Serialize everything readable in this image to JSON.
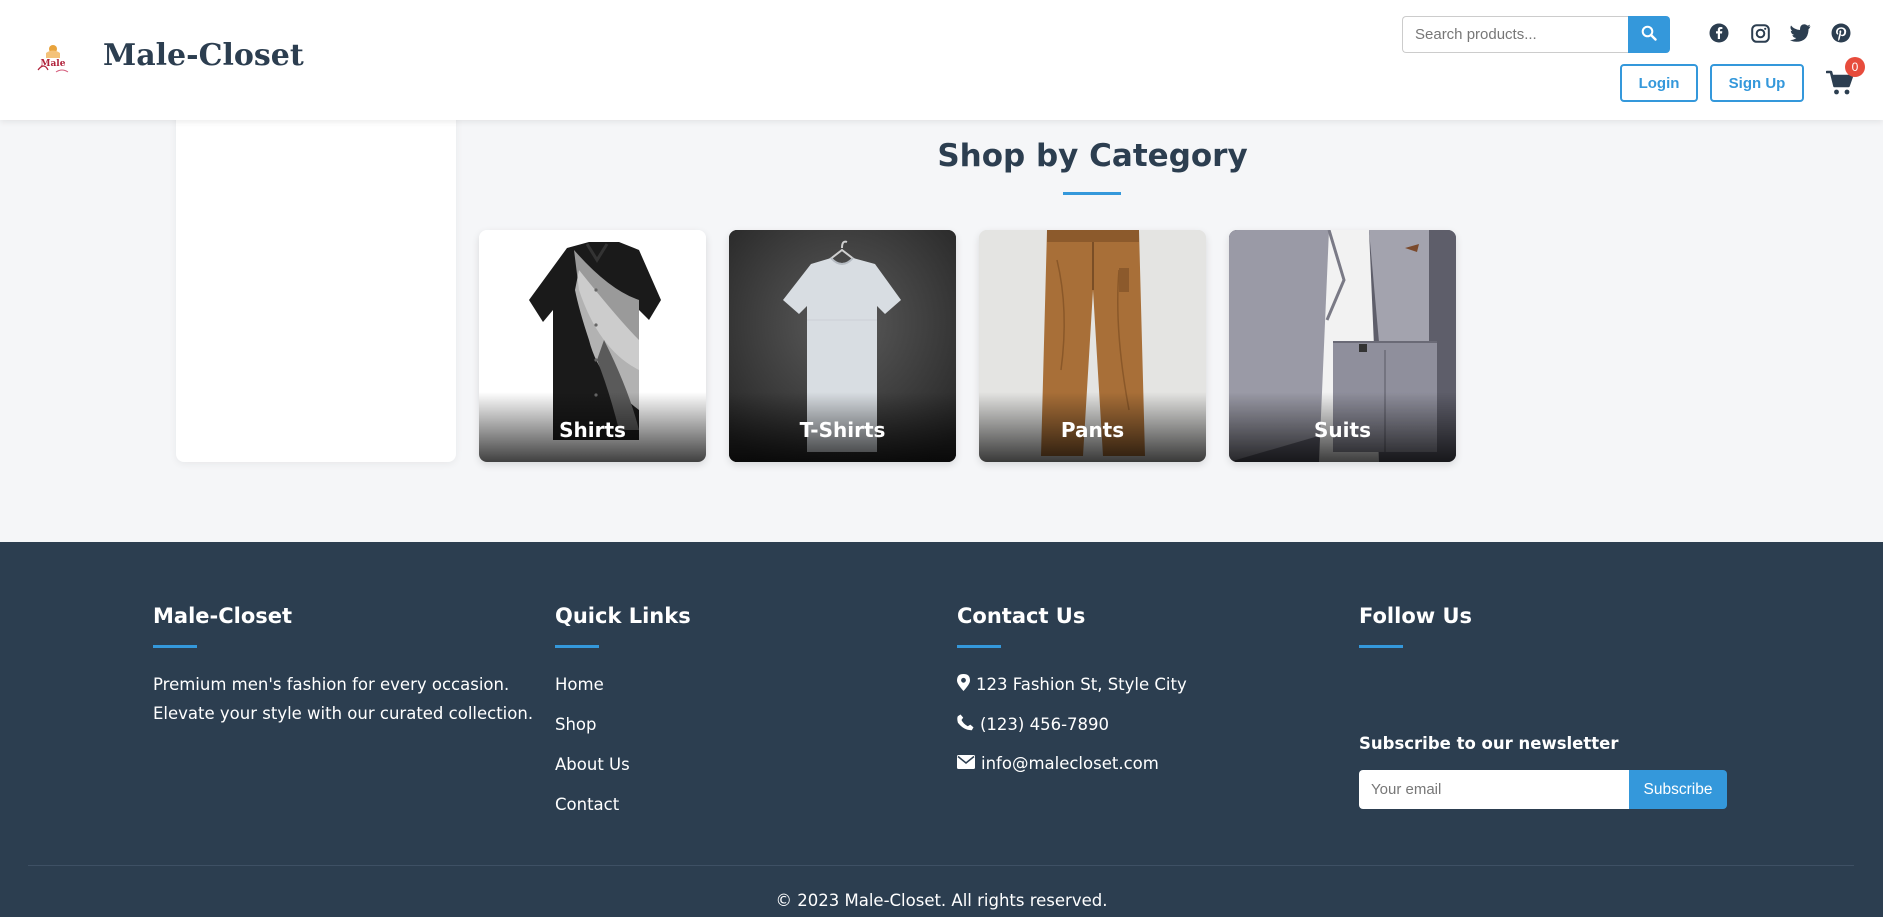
{
  "header": {
    "brand": "Male-Closet",
    "logo_text": "Male",
    "search": {
      "placeholder": "Search products...",
      "value": ""
    },
    "social_icons": [
      "facebook-icon",
      "instagram-icon",
      "twitter-icon",
      "pinterest-icon"
    ],
    "login_label": "Login",
    "signup_label": "Sign Up",
    "cart_count": "0"
  },
  "main": {
    "section_title": "Shop by Category",
    "categories": [
      {
        "label": "Shirts"
      },
      {
        "label": "T-Shirts"
      },
      {
        "label": "Pants"
      },
      {
        "label": "Suits"
      }
    ]
  },
  "footer": {
    "about": {
      "title": "Male-Closet",
      "text_line1": "Premium men's fashion for every occasion.",
      "text_line2": "Elevate your style with our curated collection."
    },
    "quick_links": {
      "title": "Quick Links",
      "items": [
        "Home",
        "Shop",
        "About Us",
        "Contact"
      ]
    },
    "contact": {
      "title": "Contact Us",
      "address": "123 Fashion St, Style City",
      "phone": "(123) 456-7890",
      "email": "info@malecloset.com"
    },
    "follow": {
      "title": "Follow Us",
      "newsletter_title": "Subscribe to our newsletter",
      "email_placeholder": "Your email",
      "subscribe_label": "Subscribe"
    },
    "copyright": "© 2023 Male-Closet. All rights reserved."
  },
  "colors": {
    "accent": "#3498db",
    "dark": "#2c3e50",
    "badge": "#e74c3c"
  }
}
